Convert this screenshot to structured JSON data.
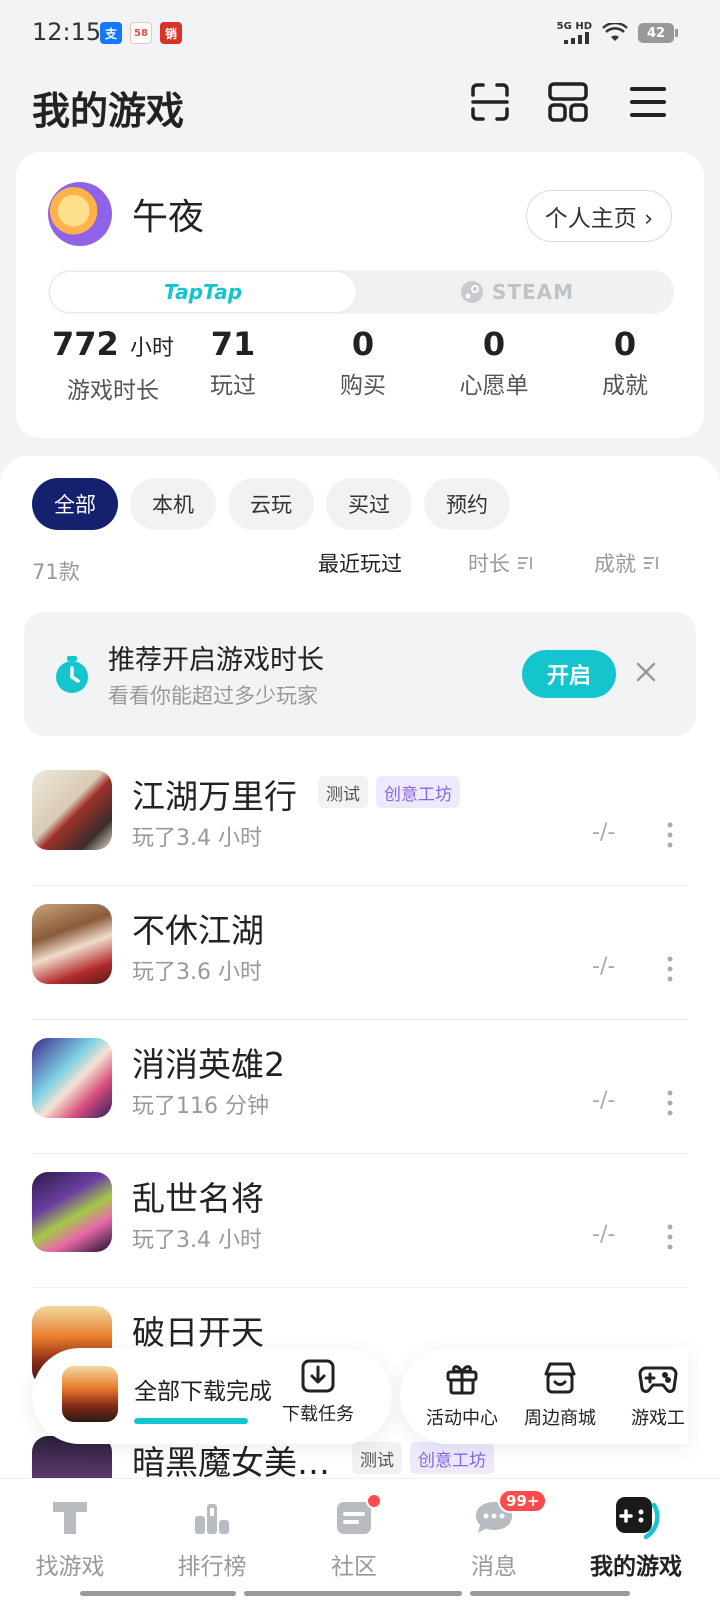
{
  "status_bar": {
    "time": "12:15",
    "apps": [
      "支",
      "58",
      "销"
    ],
    "network": "5G HD",
    "battery": "42"
  },
  "header": {
    "title": "我的游戏",
    "icons": [
      "scan-icon",
      "layout-grid-icon",
      "menu-icon"
    ]
  },
  "profile": {
    "nickname": "午夜",
    "homepage_label": "个人主页 ›",
    "platforms": [
      "TapTap",
      "STEAM"
    ],
    "active_platform": "TapTap",
    "stats": [
      {
        "value": "772",
        "unit": "小时",
        "label": "游戏时长"
      },
      {
        "value": "71",
        "unit": "",
        "label": "玩过"
      },
      {
        "value": "0",
        "unit": "",
        "label": "购买"
      },
      {
        "value": "0",
        "unit": "",
        "label": "心愿单"
      },
      {
        "value": "0",
        "unit": "",
        "label": "成就"
      }
    ]
  },
  "filters": {
    "chips": [
      "全部",
      "本机",
      "云玩",
      "买过",
      "预约"
    ],
    "active": "全部"
  },
  "list_meta": {
    "count": "71款",
    "sort_options": [
      "最近玩过",
      "时长",
      "成就"
    ],
    "active_sort": "最近玩过"
  },
  "tip": {
    "title": "推荐开启游戏时长",
    "subtitle": "看看你能超过多少玩家",
    "button": "开启"
  },
  "games": [
    {
      "name": "江湖万里行",
      "playtime": "玩了3.4 小时",
      "score": "-/-",
      "tags": [
        "测试",
        "创意工坊"
      ]
    },
    {
      "name": "不休江湖",
      "playtime": "玩了3.6 小时",
      "score": "-/-",
      "tags": []
    },
    {
      "name": "消消英雄2",
      "playtime": "玩了116 分钟",
      "score": "-/-",
      "tags": []
    },
    {
      "name": "乱世名将",
      "playtime": "玩了3.4 小时",
      "score": "-/-",
      "tags": []
    },
    {
      "name": "破日开天",
      "playtime": "",
      "score": "",
      "tags": []
    },
    {
      "name": "暗黑魔女美…",
      "playtime": "",
      "score": "",
      "tags": [
        "测试",
        "创意工坊"
      ]
    }
  ],
  "download": {
    "status": "全部下载完成",
    "progress": 1.0,
    "task_label": "下载任务"
  },
  "shortcuts": [
    "活动中心",
    "周边商城",
    "游戏工"
  ],
  "bottom_nav": {
    "items": [
      "找游戏",
      "排行榜",
      "社区",
      "消息",
      "我的游戏"
    ],
    "active": "我的游戏",
    "message_badge": "99+"
  },
  "colors": {
    "accent": "#15c5ce",
    "active_chip": "#15206e",
    "workshop_tag": "#8966e6",
    "badge": "#ff4b4b"
  }
}
